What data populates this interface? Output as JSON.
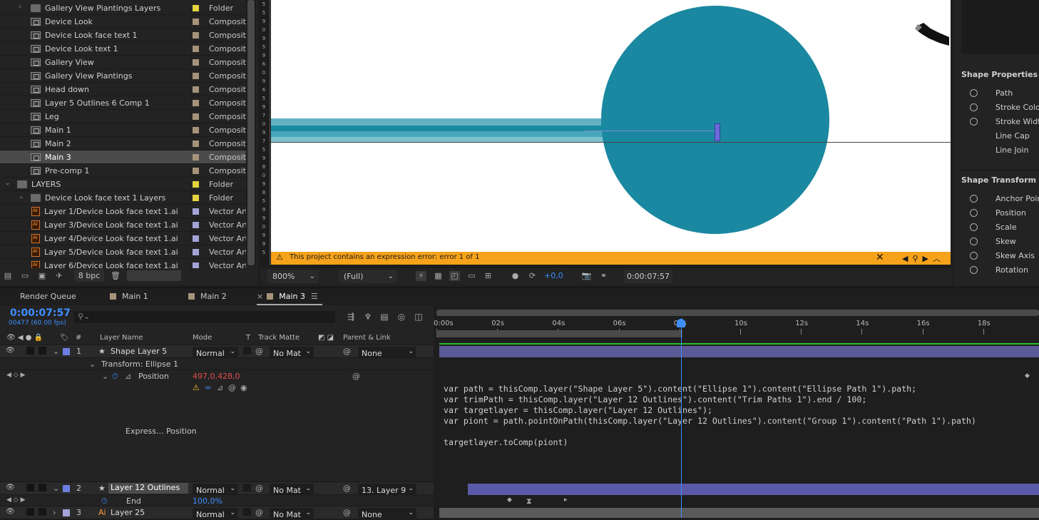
{
  "project": {
    "items": [
      {
        "name": "Gallery View Piantings Layers",
        "type": "Folder",
        "kind": "folder",
        "indent": 1,
        "twirl": "›",
        "label": "#e6d340"
      },
      {
        "name": "Device Look",
        "type": "Compositi",
        "kind": "comp",
        "indent": 1,
        "twirl": "",
        "label": "#a6937a"
      },
      {
        "name": "Device Look face text 1",
        "type": "Compositi",
        "kind": "comp",
        "indent": 1,
        "twirl": "",
        "label": "#a6937a"
      },
      {
        "name": "Device Look text 1",
        "type": "Compositi",
        "kind": "comp",
        "indent": 1,
        "twirl": "",
        "label": "#a6937a"
      },
      {
        "name": "Gallery View",
        "type": "Compositi",
        "kind": "comp",
        "indent": 1,
        "twirl": "",
        "label": "#a6937a"
      },
      {
        "name": "Gallery View Piantings",
        "type": "Compositi",
        "kind": "comp",
        "indent": 1,
        "twirl": "",
        "label": "#a6937a"
      },
      {
        "name": "Head down",
        "type": "Compositi",
        "kind": "comp",
        "indent": 1,
        "twirl": "",
        "label": "#a6937a"
      },
      {
        "name": "Layer 5 Outlines 6 Comp 1",
        "type": "Compositi",
        "kind": "comp",
        "indent": 1,
        "twirl": "",
        "label": "#a6937a"
      },
      {
        "name": "Leg",
        "type": "Compositi",
        "kind": "comp",
        "indent": 1,
        "twirl": "",
        "label": "#a6937a"
      },
      {
        "name": "Main 1",
        "type": "Compositi",
        "kind": "comp",
        "indent": 1,
        "twirl": "",
        "label": "#a6937a"
      },
      {
        "name": "Main 2",
        "type": "Compositi",
        "kind": "comp",
        "indent": 1,
        "twirl": "",
        "label": "#a6937a"
      },
      {
        "name": "Main 3",
        "type": "Compositi",
        "kind": "comp",
        "indent": 1,
        "twirl": "",
        "label": "#a6937a",
        "selected": true
      },
      {
        "name": "Pre-comp 1",
        "type": "Compositi",
        "kind": "comp",
        "indent": 1,
        "twirl": "",
        "label": "#a6937a"
      },
      {
        "name": "LAYERS",
        "type": "Folder",
        "kind": "folder",
        "indent": 0,
        "twirl": "⌄",
        "label": "#e6d340"
      },
      {
        "name": "Device Look face text 1 Layers",
        "type": "Folder",
        "kind": "folder",
        "indent": 1,
        "twirl": "⌄",
        "label": "#e6d340"
      },
      {
        "name": "Layer 1/Device Look face text 1.ai",
        "type": "Vector Art",
        "kind": "ai",
        "indent": 2,
        "twirl": "",
        "label": "#a4a4d8"
      },
      {
        "name": "Layer 3/Device Look face text 1.ai",
        "type": "Vector Art",
        "kind": "ai",
        "indent": 2,
        "twirl": "",
        "label": "#a4a4d8"
      },
      {
        "name": "Layer 4/Device Look face text 1.ai",
        "type": "Vector Art",
        "kind": "ai",
        "indent": 2,
        "twirl": "",
        "label": "#a4a4d8"
      },
      {
        "name": "Layer 5/Device Look face text 1.ai",
        "type": "Vector Art",
        "kind": "ai",
        "indent": 2,
        "twirl": "",
        "label": "#a4a4d8"
      },
      {
        "name": "Layer 6/Device Look face text 1.ai",
        "type": "Vector Art",
        "kind": "ai",
        "indent": 2,
        "twirl": "",
        "label": "#a4a4d8"
      }
    ],
    "bpc": "8 bpc"
  },
  "ruler": {
    "marks": [
      "5",
      "5",
      "9",
      "0",
      "9",
      "5",
      "9",
      "6",
      "0",
      "9",
      "6",
      "5",
      "9",
      "7",
      "0",
      "9",
      "7",
      "5",
      "9",
      "8",
      "0",
      "9",
      "8",
      "5",
      "9",
      "9",
      "0",
      "9",
      "9",
      "5"
    ]
  },
  "viewer": {
    "warning": "This project contains an expression error: error 1 of 1",
    "zoom": "800%",
    "resolution": "(Full)",
    "exposure": "+0,0",
    "time": "0:00:07:57"
  },
  "right_panel": {
    "shape_properties_title": "Shape Properties",
    "shape_properties": [
      "Path",
      "Stroke Color",
      "Stroke Width",
      "Line Cap",
      "Line Join"
    ],
    "shape_transform_title": "Shape Transform",
    "shape_transform": [
      "Anchor Point",
      "Position",
      "Scale",
      "Skew",
      "Skew Axis",
      "Rotation"
    ]
  },
  "timeline": {
    "tabs": [
      "Render Queue",
      "Main 1",
      "Main 2",
      "Main 3"
    ],
    "timecode": "0:00:07:57",
    "frames": "00477 (60.00 fps)",
    "columns": {
      "num": "#",
      "layer_name": "Layer Name",
      "mode": "Mode",
      "t": "T",
      "track_matte": "Track Matte",
      "parent": "Parent & Link"
    },
    "layer1": {
      "num": "1",
      "name": "Shape Layer 5",
      "mode": "Normal",
      "matte": "No Mat",
      "parent": "None"
    },
    "transform_label": "Transform: Ellipse 1",
    "position_label": "Position",
    "position_value": "497,0,428,0",
    "expr_label": "Express... Position",
    "layer2": {
      "num": "2",
      "name": "Layer 12 Outlines",
      "mode": "Normal",
      "matte": "No Mat",
      "parent": "13. Layer 9"
    },
    "end_label": "End",
    "end_value": "100,0%",
    "layer3": {
      "num": "3",
      "name": "Layer 25",
      "mode": "Normal",
      "matte": "No Mat",
      "parent": "None"
    },
    "ticks": [
      "0:00s",
      "02s",
      "04s",
      "06s",
      "08s",
      "10s",
      "12s",
      "14s",
      "16s",
      "18s"
    ],
    "expression": "var path = thisComp.layer(\"Shape Layer 5\").content(\"Ellipse 1\").content(\"Ellipse Path 1\").path;\nvar trimPath = thisComp.layer(\"Layer 12 Outlines\").content(\"Trim Paths 1\").end / 100;\nvar targetlayer = thisComp.layer(\"Layer 12 Outlines\");\nvar piont = path.pointOnPath(thisComp.layer(\"Layer 12 Outlines\").content(\"Group 1\").content(\"Path 1\").path)\n\ntargetlayer.toComp(piont)"
  },
  "colors": {
    "accent": "#3d8fff",
    "warning": "#f6a21a",
    "shape_fill": "#1a88a0",
    "layer_bar": "#5a5a96"
  }
}
